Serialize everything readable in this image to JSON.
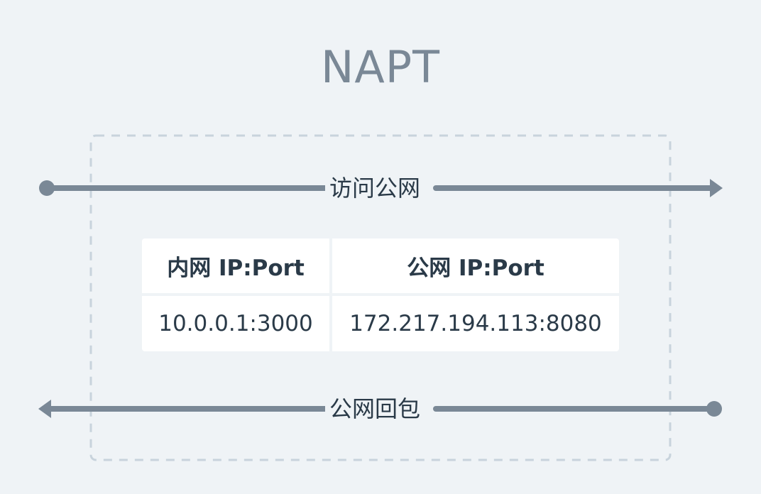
{
  "title": "NAPT",
  "arrows": {
    "outbound_label": "访问公网",
    "inbound_label": "公网回包"
  },
  "table": {
    "headers": [
      "内网 IP:Port",
      "公网 IP:Port"
    ],
    "rows": [
      [
        "10.0.0.1:3000",
        "172.217.194.113:8080"
      ]
    ]
  },
  "colors": {
    "background": "#eff3f6",
    "line": "#7a8896",
    "dashed_border": "#c8d3dc",
    "text": "#2a3a48"
  }
}
